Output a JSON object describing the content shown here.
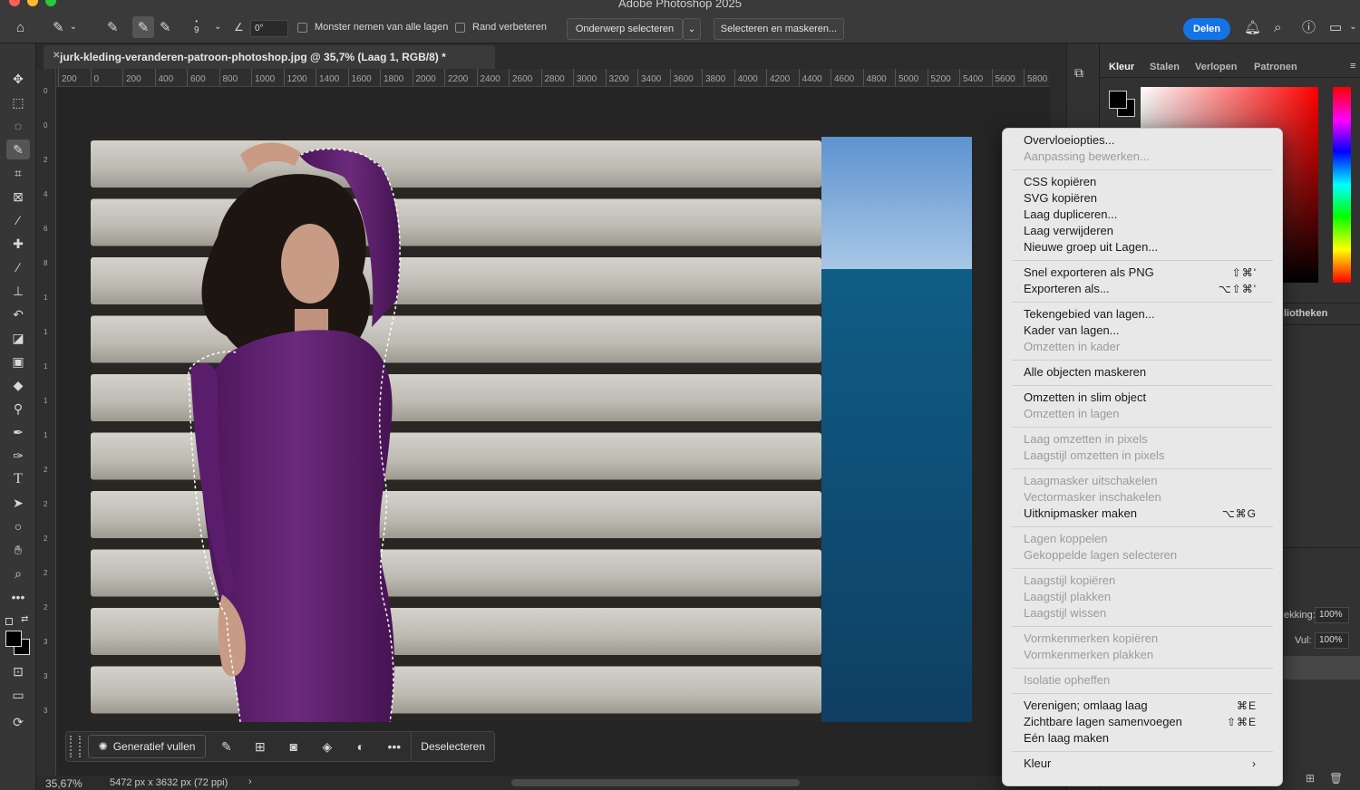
{
  "app": {
    "title": "Adobe Photoshop 2025"
  },
  "options_bar": {
    "brush_size": "9",
    "angle": "0°",
    "sample_all_layers_label": "Monster nemen van alle lagen",
    "enhance_edge_label": "Rand verbeteren",
    "select_subject_label": "Onderwerp selecteren",
    "select_and_mask_label": "Selecteren en maskeren...",
    "share_label": "Delen"
  },
  "document": {
    "tab_title": "jurk-kleding-veranderen-patroon-photoshop.jpg @ 35,7% (Laag 1, RGB/8) *",
    "ruler_ticks": [
      "200",
      "0",
      "200",
      "400",
      "600",
      "800",
      "1000",
      "1200",
      "1400",
      "1600",
      "1800",
      "2000",
      "2200",
      "2400",
      "2600",
      "2800",
      "3000",
      "3200",
      "3400",
      "3600",
      "3800",
      "4000",
      "4200",
      "4400",
      "4600",
      "4800",
      "5000",
      "5200",
      "5400",
      "5600",
      "5800"
    ],
    "ruler_v_ticks": [
      "0",
      "0",
      "2",
      "4",
      "6",
      "8",
      "1",
      "1",
      "1",
      "1",
      "1",
      "2",
      "2",
      "2",
      "2",
      "2",
      "3",
      "3",
      "3"
    ]
  },
  "status": {
    "zoom": "35,67%",
    "info": "5472 px x 3632 px (72 ppi)"
  },
  "taskbar": {
    "generative_fill_label": "Generatief vullen",
    "deselect_label": "Deselecteren"
  },
  "panel": {
    "tabs": [
      "Kleur",
      "Stalen",
      "Verlopen",
      "Patronen"
    ],
    "libraries_label": "liotheken",
    "opacity_label": "ekking:",
    "opacity_value": "100%",
    "fill_label": "Vul:",
    "fill_value": "100%"
  },
  "context_menu": {
    "groups": [
      [
        {
          "label": "Overvloeiopties...",
          "disabled": false,
          "shortcut": ""
        },
        {
          "label": "Aanpassing bewerken...",
          "disabled": true,
          "shortcut": ""
        }
      ],
      [
        {
          "label": "CSS kopiëren",
          "disabled": false,
          "shortcut": ""
        },
        {
          "label": "SVG kopiëren",
          "disabled": false,
          "shortcut": ""
        },
        {
          "label": "Laag dupliceren...",
          "disabled": false,
          "shortcut": ""
        },
        {
          "label": "Laag verwijderen",
          "disabled": false,
          "shortcut": ""
        },
        {
          "label": "Nieuwe groep uit Lagen...",
          "disabled": false,
          "shortcut": ""
        }
      ],
      [
        {
          "label": "Snel exporteren als PNG",
          "disabled": false,
          "shortcut": "⇧⌘'"
        },
        {
          "label": "Exporteren als...",
          "disabled": false,
          "shortcut": "⌥⇧⌘'"
        }
      ],
      [
        {
          "label": "Tekengebied van lagen...",
          "disabled": false,
          "shortcut": ""
        },
        {
          "label": "Kader van lagen...",
          "disabled": false,
          "shortcut": ""
        },
        {
          "label": "Omzetten in kader",
          "disabled": true,
          "shortcut": ""
        }
      ],
      [
        {
          "label": "Alle objecten maskeren",
          "disabled": false,
          "shortcut": ""
        }
      ],
      [
        {
          "label": "Omzetten in slim object",
          "disabled": false,
          "shortcut": ""
        },
        {
          "label": "Omzetten in lagen",
          "disabled": true,
          "shortcut": ""
        }
      ],
      [
        {
          "label": "Laag omzetten in pixels",
          "disabled": true,
          "shortcut": ""
        },
        {
          "label": "Laagstijl omzetten in pixels",
          "disabled": true,
          "shortcut": ""
        }
      ],
      [
        {
          "label": "Laagmasker uitschakelen",
          "disabled": true,
          "shortcut": ""
        },
        {
          "label": "Vectormasker inschakelen",
          "disabled": true,
          "shortcut": ""
        },
        {
          "label": "Uitknipmasker maken",
          "disabled": false,
          "shortcut": "⌥⌘G"
        }
      ],
      [
        {
          "label": "Lagen koppelen",
          "disabled": true,
          "shortcut": ""
        },
        {
          "label": "Gekoppelde lagen selecteren",
          "disabled": true,
          "shortcut": ""
        }
      ],
      [
        {
          "label": "Laagstijl kopiëren",
          "disabled": true,
          "shortcut": ""
        },
        {
          "label": "Laagstijl plakken",
          "disabled": true,
          "shortcut": ""
        },
        {
          "label": "Laagstijl wissen",
          "disabled": true,
          "shortcut": ""
        }
      ],
      [
        {
          "label": "Vormkenmerken kopiëren",
          "disabled": true,
          "shortcut": ""
        },
        {
          "label": "Vormkenmerken plakken",
          "disabled": true,
          "shortcut": ""
        }
      ],
      [
        {
          "label": "Isolatie opheffen",
          "disabled": true,
          "shortcut": ""
        }
      ],
      [
        {
          "label": "Verenigen; omlaag laag",
          "disabled": false,
          "shortcut": "⌘E"
        },
        {
          "label": "Zichtbare lagen samenvoegen",
          "disabled": false,
          "shortcut": "⇧⌘E"
        },
        {
          "label": "Eén laag maken",
          "disabled": false,
          "shortcut": ""
        }
      ],
      [
        {
          "label": "Kleur",
          "disabled": false,
          "shortcut": "›"
        }
      ]
    ]
  },
  "colors": {
    "accent": "#1473e6",
    "dress": "#5e1f6e",
    "sea": "#15577a",
    "sky": "#6fa3d6",
    "wood": "#bfbdb6"
  }
}
